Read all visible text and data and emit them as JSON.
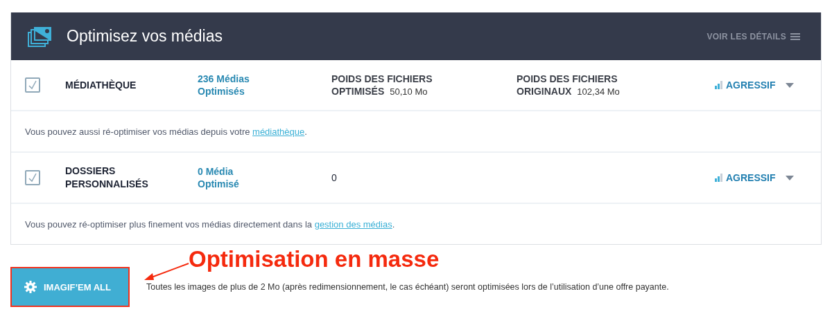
{
  "header": {
    "title": "Optimisez vos médias",
    "details_link": "VOIR LES DÉTAILS"
  },
  "sections": [
    {
      "row": {
        "checked": true,
        "label": "MÉDIATHÈQUE",
        "count": "236 Médias Optimisés",
        "optimized": {
          "label": "POIDS DES FICHIERS OPTIMISÉS",
          "value": "50,10 Mo"
        },
        "original": {
          "label": "POIDS DES FICHIERS ORIGINAUX",
          "value": "102,34 Mo"
        },
        "level_label": "AGRESSIF"
      },
      "notice": {
        "text": "Vous pouvez aussi ré-optimiser vos médias depuis votre ",
        "link": "médiathèque",
        "end": "."
      }
    },
    {
      "row": {
        "checked": true,
        "label": "DOSSIERS PERSONNALISÉS",
        "count": "0 Média Optimisé",
        "optimized": {
          "value": "0"
        },
        "level_label": "AGRESSIF"
      },
      "notice": {
        "text": "Vous pouvez ré-optimiser plus finement vos médias directement dans la ",
        "link": "gestion des médias",
        "end": "."
      }
    }
  ],
  "bulk": {
    "button": "IMAGIF’EM ALL",
    "note": "Toutes les images de plus de 2 Mo (après redimensionnement, le cas échéant) seront optimisées lors de l’utilisation d’une offre payante."
  },
  "annotation": {
    "text": "Optimisation en masse"
  }
}
